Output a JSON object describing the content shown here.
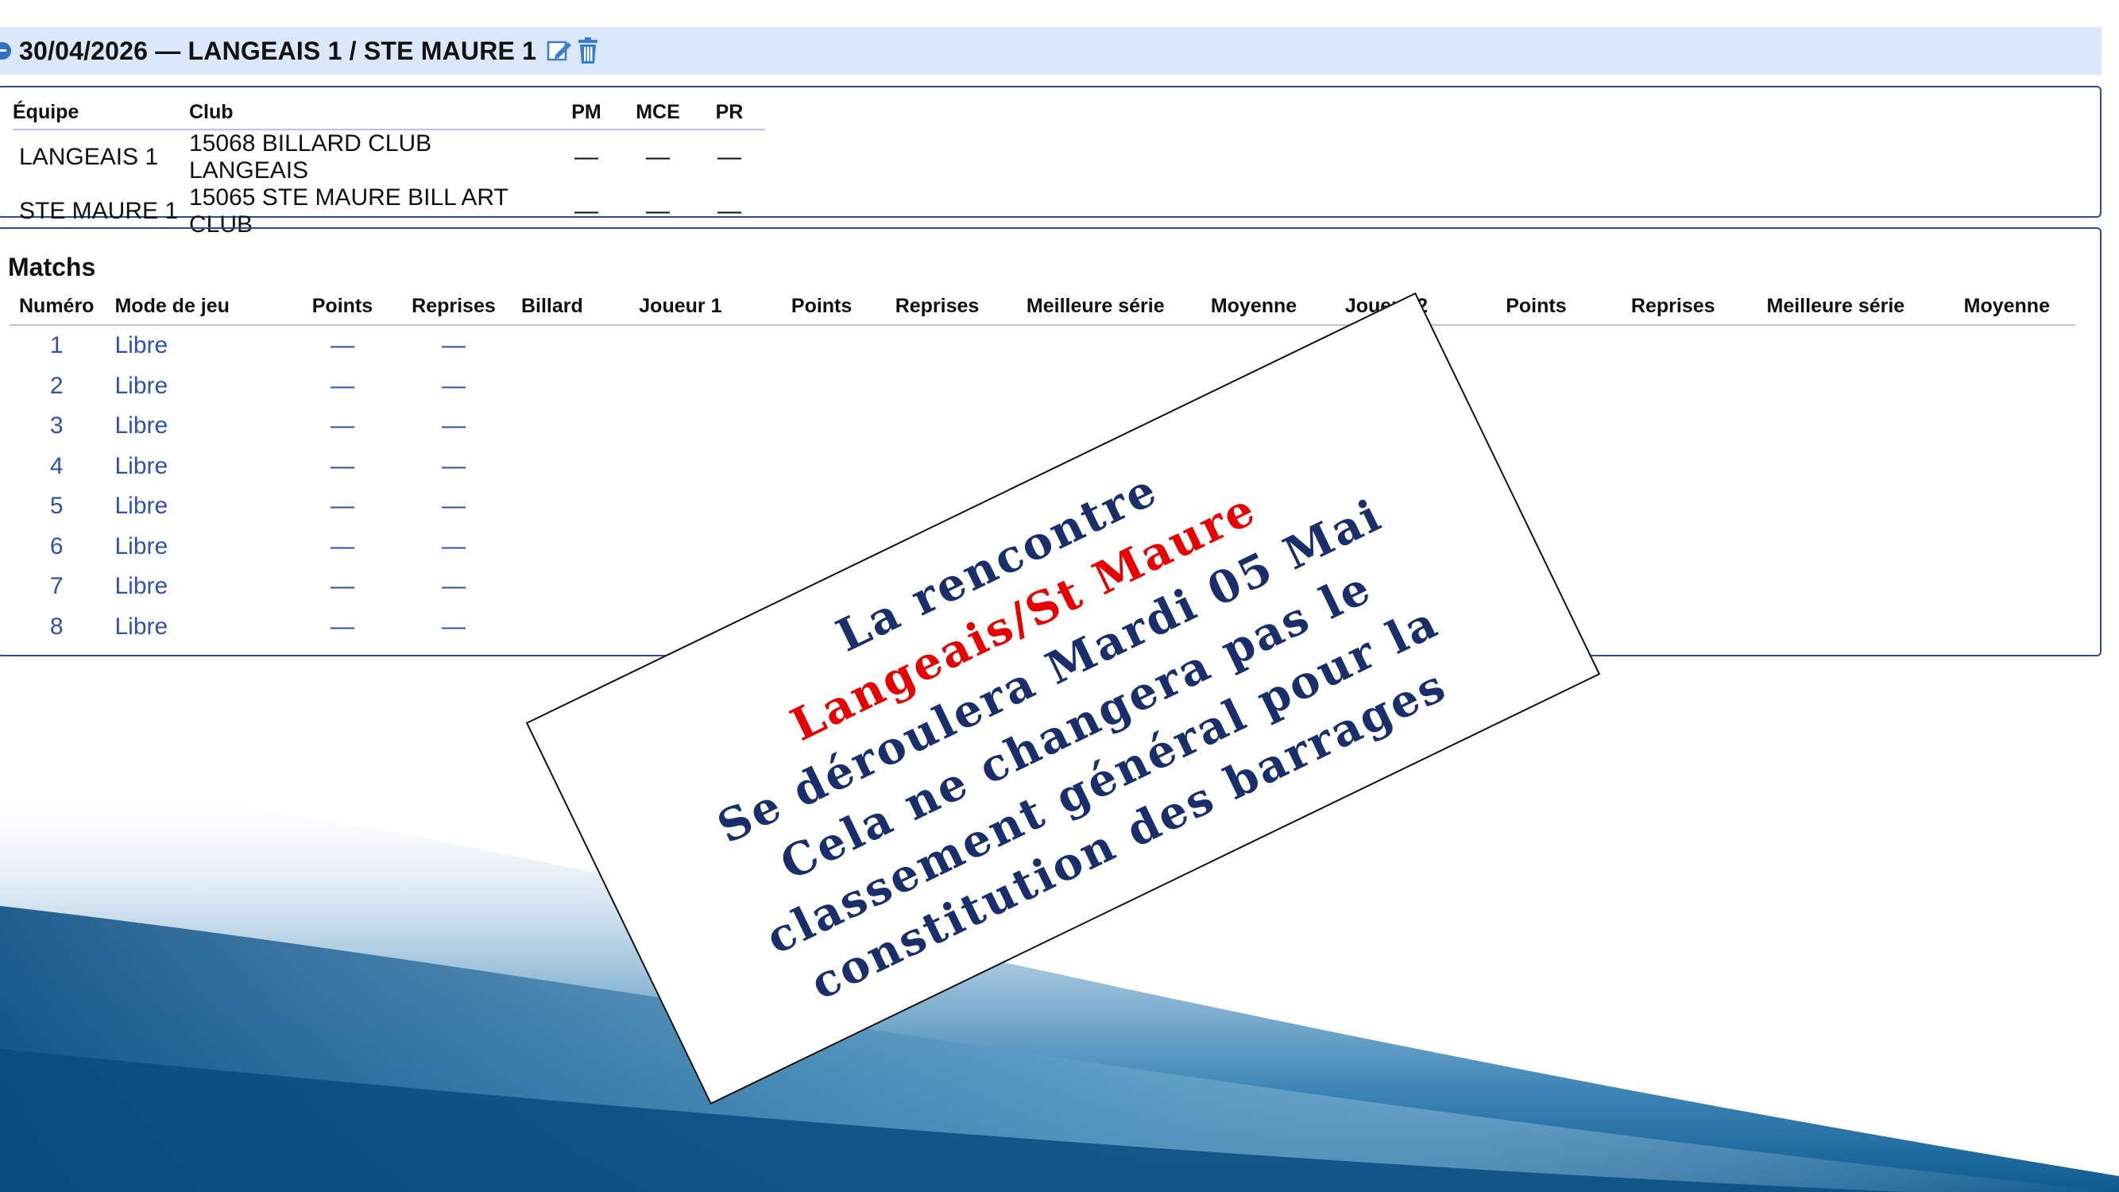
{
  "header": {
    "title": "30/04/2026 — LANGEAIS 1 / STE MAURE 1"
  },
  "teams": {
    "columns": [
      "Équipe",
      "Club",
      "PM",
      "MCE",
      "PR"
    ],
    "rows": [
      {
        "team": "LANGEAIS 1",
        "club": "15068 BILLARD CLUB LANGEAIS",
        "pm": "—",
        "mce": "—",
        "pr": "—"
      },
      {
        "team": "STE MAURE 1",
        "club": "15065 STE MAURE BILL ART CLUB",
        "pm": "—",
        "mce": "—",
        "pr": "—"
      }
    ]
  },
  "matchs": {
    "title": "Matchs",
    "columns": [
      "Numéro",
      "Mode de jeu",
      "Points",
      "Reprises",
      "Billard",
      "Joueur 1",
      "Points",
      "Reprises",
      "Meilleure série",
      "Moyenne",
      "Joueur 2",
      "Points",
      "Reprises",
      "Meilleure série",
      "Moyenne"
    ],
    "rows": [
      {
        "num": "1",
        "mode": "Libre",
        "points": "—",
        "reprises": "—"
      },
      {
        "num": "2",
        "mode": "Libre",
        "points": "—",
        "reprises": "—"
      },
      {
        "num": "3",
        "mode": "Libre",
        "points": "—",
        "reprises": "—"
      },
      {
        "num": "4",
        "mode": "Libre",
        "points": "—",
        "reprises": "—"
      },
      {
        "num": "5",
        "mode": "Libre",
        "points": "—",
        "reprises": "—"
      },
      {
        "num": "6",
        "mode": "Libre",
        "points": "—",
        "reprises": "—"
      },
      {
        "num": "7",
        "mode": "Libre",
        "points": "—",
        "reprises": "—"
      },
      {
        "num": "8",
        "mode": "Libre",
        "points": "—",
        "reprises": "—"
      }
    ]
  },
  "notice": {
    "line1": "La rencontre",
    "line2": "Langeais/St Maure",
    "line3": "Se déroulera Mardi 05 Mai",
    "line4": "Cela ne changera pas le",
    "line5": "classement général pour la",
    "line6": "constitution des barrages"
  },
  "colors": {
    "header_bg": "#dbe8fb",
    "box_border": "#2c4b94",
    "link_blue": "#2f52a8",
    "notice_navy": "#1a2e6b",
    "notice_red": "#e60000"
  }
}
